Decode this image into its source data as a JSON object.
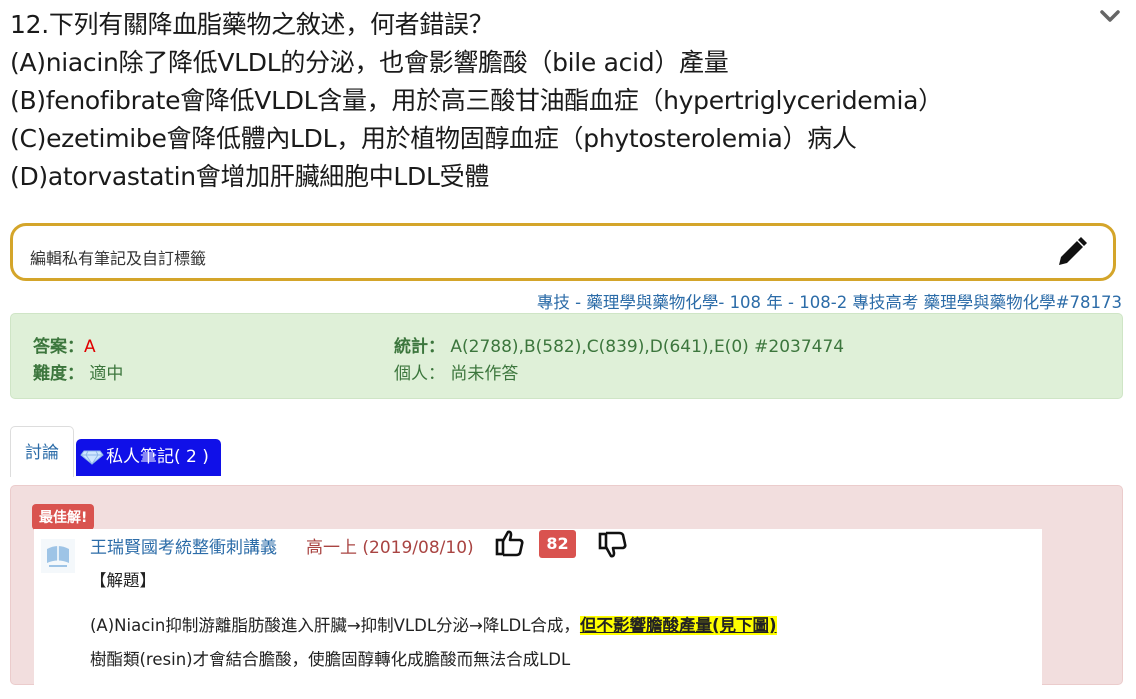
{
  "question": {
    "lines": [
      "12.下列有關降血脂藥物之敘述，何者錯誤？",
      "(A)niacin除了降低VLDL的分泌，也會影響膽酸（bile acid）產量",
      "(B)fenofibrate會降低VLDL含量，用於高三酸甘油酯血症（hypertriglyceridemia）",
      "(C)ezetimibe會降低體內LDL，用於植物固醇血症（phytosterolemia）病人",
      "(D)atorvastatin會增加肝臟細胞中LDL受體"
    ]
  },
  "note_box": {
    "placeholder": "編輯私有筆記及自訂標籤"
  },
  "source": {
    "category": "專技",
    "sep1": " - ",
    "subject": "藥理學與藥物化學",
    "sep2": "- ",
    "exam": "108 年 - 108-2 專技高考 藥理學與藥物化學#78173"
  },
  "info": {
    "answer_label": "答案：",
    "answer_value": "A",
    "difficulty_label": "難度：",
    "difficulty_value": "適中",
    "stats_label": "統計：",
    "stats_value": "A(2788),B(582),C(839),D(641),E(0) #2037474",
    "personal_label": "個人：",
    "personal_value": "尚未作答"
  },
  "tabs": {
    "discussion": "討論",
    "private_notes": "私人筆記( 2 )"
  },
  "best_answer": {
    "badge": "最佳解!",
    "author": "王瑞賢國考統整衝刺講義",
    "meta": "高一上 (2019/08/10)",
    "votes": "82",
    "heading": "【解題】",
    "line1_prefix": "(A)Niacin抑制游離脂肪酸進入肝臟→抑制VLDL分泌→降LDL合成，",
    "line1_highlight": "但不影響膽酸產量(見下圖)",
    "line2": "樹酯類(resin)才會結合膽酸，使膽固醇轉化成膽酸而無法合成LDL"
  }
}
